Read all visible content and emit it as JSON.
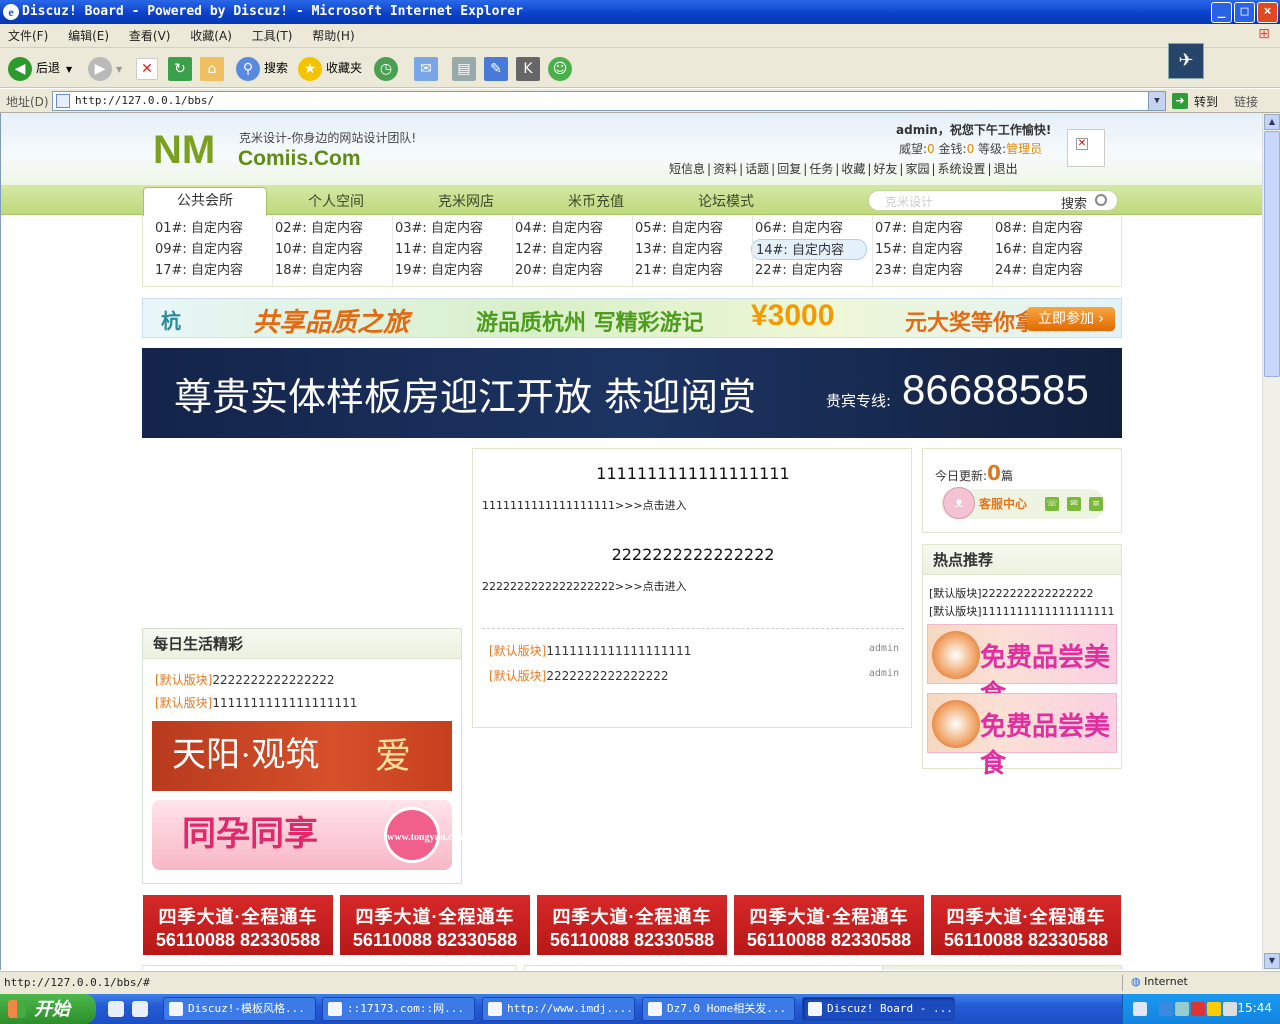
{
  "window": {
    "title": "Discuz! Board - Powered by Discuz! - Microsoft Internet Explorer",
    "minimize": "_",
    "maximize": "□",
    "close": "×"
  },
  "menu": [
    "文件(F)",
    "编辑(E)",
    "查看(V)",
    "收藏(A)",
    "工具(T)",
    "帮助(H)"
  ],
  "toolbar": {
    "back": "后退",
    "search": "搜索",
    "favorites": "收藏夹"
  },
  "address": {
    "label": "地址(D)",
    "url": "http://127.0.0.1/bbs/",
    "go": "转到",
    "links": "链接"
  },
  "site": {
    "slogan": "克米设计-你身边的网站设计团队!",
    "name": "Comiis.Com",
    "logo_text": "NM",
    "greeting": "admin，祝您下午工作愉快!",
    "stats": {
      "prestige_label": "威望:",
      "prestige": "0",
      "money_label": "金钱:",
      "money": "0",
      "level_label": "等级:",
      "level": "管理员"
    },
    "user_nav": [
      "短信息",
      "资料",
      "话题",
      "回复",
      "任务",
      "收藏",
      "好友",
      "家园",
      "系统设置",
      "退出"
    ]
  },
  "main_nav": {
    "active": "公共会所",
    "tabs": [
      "个人空间",
      "克米网店",
      "米币充值",
      "论坛模式"
    ],
    "search_placeholder": "克米设计",
    "search_button": "搜索"
  },
  "custom_links": [
    "01#: 自定内容",
    "02#: 自定内容",
    "03#: 自定内容",
    "04#: 自定内容",
    "05#: 自定内容",
    "06#: 自定内容",
    "07#: 自定内容",
    "08#: 自定内容",
    "09#: 自定内容",
    "10#: 自定内容",
    "11#: 自定内容",
    "12#: 自定内容",
    "13#: 自定内容",
    "14#: 自定内容",
    "15#: 自定内容",
    "16#: 自定内容",
    "17#: 自定内容",
    "18#: 自定内容",
    "19#: 自定内容",
    "20#: 自定内容",
    "21#: 自定内容",
    "22#: 自定内容",
    "23#: 自定内容",
    "24#: 自定内容"
  ],
  "banner1": {
    "logo": "杭",
    "slogan1": "共享品质之旅",
    "slogan2": "游品质杭州  写精彩游记",
    "prize": "¥3000",
    "prize_suffix": "元大奖等你拿",
    "join": "立即参加 ›"
  },
  "banner2": {
    "headline": "尊贵实体样板房迎江开放  恭迎阅赏",
    "hotline_label": "贵宾专线:",
    "phone": "86688585"
  },
  "daily": {
    "title": "每日生活精彩",
    "items": [
      {
        "cat": "[默认版块]",
        "text": "2222222222222222"
      },
      {
        "cat": "[默认版块]",
        "text": "1111111111111111111"
      }
    ],
    "ad1": "天阳·观筑",
    "ad1_love": "爱",
    "ad2": "同孕同享",
    "ad2_badge": "www.tongyun.com"
  },
  "center": {
    "post1_title": "1111111111111111111",
    "post1_summary": "1111111111111111111>>>点击进入",
    "post2_title": "2222222222222222",
    "post2_summary": "2222222222222222222>>>点击进入",
    "rows": [
      {
        "cat": "[默认版块]",
        "text": "1111111111111111111",
        "author": "admin"
      },
      {
        "cat": "[默认版块]",
        "text": "2222222222222222",
        "author": "admin"
      }
    ]
  },
  "today": {
    "label": "今日更新:",
    "count": "0",
    "unit": "篇",
    "service": "客服中心"
  },
  "hot": {
    "title": "热点推荐",
    "items": [
      "[默认版块]2222222222222222",
      "[默认版块]1111111111111111111"
    ],
    "ad_text": "免费品尝美食"
  },
  "red_ads": {
    "line1": "四季大道·全程通车",
    "line2": "56110088  82330588"
  },
  "status": {
    "url": "http://127.0.0.1/bbs/#",
    "zone": "Internet"
  },
  "taskbar": {
    "start": "开始",
    "tasks": [
      "Discuz!-模板风格...",
      "::17173.com::网...",
      "http://www.imdj....",
      "Dz7.0 Home相关发...",
      "Discuz! Board - ..."
    ],
    "clock": "15:44"
  }
}
